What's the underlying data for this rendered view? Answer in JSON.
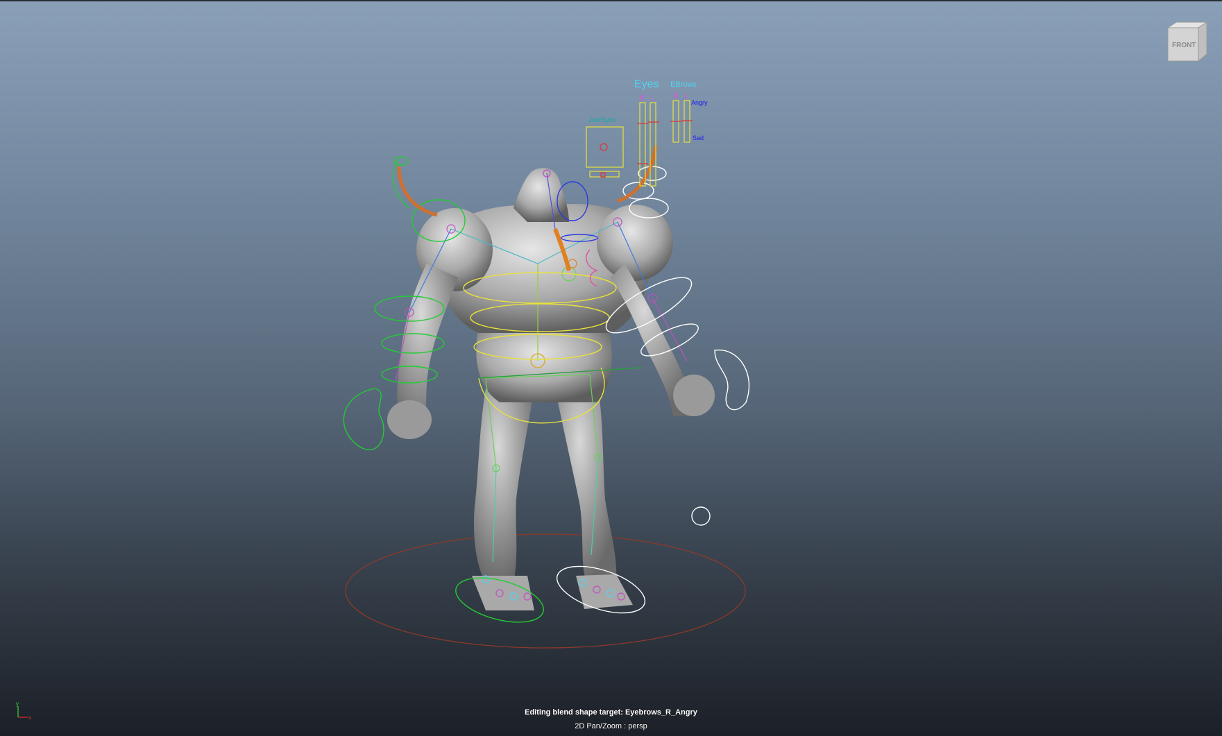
{
  "viewport": {
    "camera": "persp",
    "view_cube_label": "FRONT",
    "status_message": "Editing blend shape target: Eyebrows_R_Angry",
    "camera_mode": "2D Pan/Zoom : persp",
    "axis_y_label": "y",
    "axis_x_label": "x"
  },
  "face_controls": {
    "jaw_label": "JawSync",
    "eyes_label": "Eyes",
    "brows_label": "EBrows",
    "eyes_r": "R",
    "eyes_l": "L",
    "brows_r": "R",
    "brows_l": "L",
    "angry_label": "Angry",
    "sad_label": "Sad"
  },
  "colors": {
    "gradient_top": "#8aa0b8",
    "gradient_bottom": "#1c2027",
    "control_yellow": "#e8e23a",
    "control_green": "#22cc33",
    "control_white": "#ffffff",
    "ground_circle": "#8b3a2a",
    "label_cyan": "#4fd4f0",
    "label_blue": "#1a1aee"
  }
}
